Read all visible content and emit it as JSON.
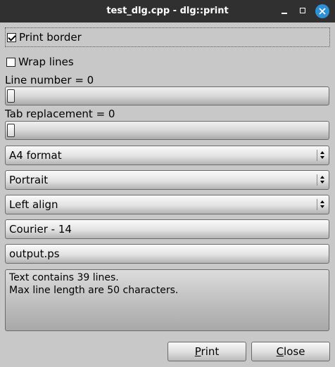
{
  "window": {
    "title": "test_dlg.cpp - dlg::print"
  },
  "options": {
    "print_border": {
      "label": "Print border",
      "checked": true
    },
    "wrap_lines": {
      "label": "Wrap lines",
      "checked": false
    }
  },
  "line_number": {
    "label": "Line number = 0",
    "value": 0
  },
  "tab_replacement": {
    "label": "Tab replacement = 0",
    "value": 0
  },
  "selects": {
    "page_format": "A4 format",
    "orientation": "Portrait",
    "alignment": "Left align"
  },
  "font_field": "Courier - 14",
  "output_field": "output.ps",
  "info": {
    "line1": "Text contains 39 lines.",
    "line2": "Max line length are 50 characters."
  },
  "buttons": {
    "print": {
      "mnemonic": "P",
      "rest": "rint"
    },
    "close": {
      "mnemonic": "C",
      "rest": "lose"
    }
  }
}
